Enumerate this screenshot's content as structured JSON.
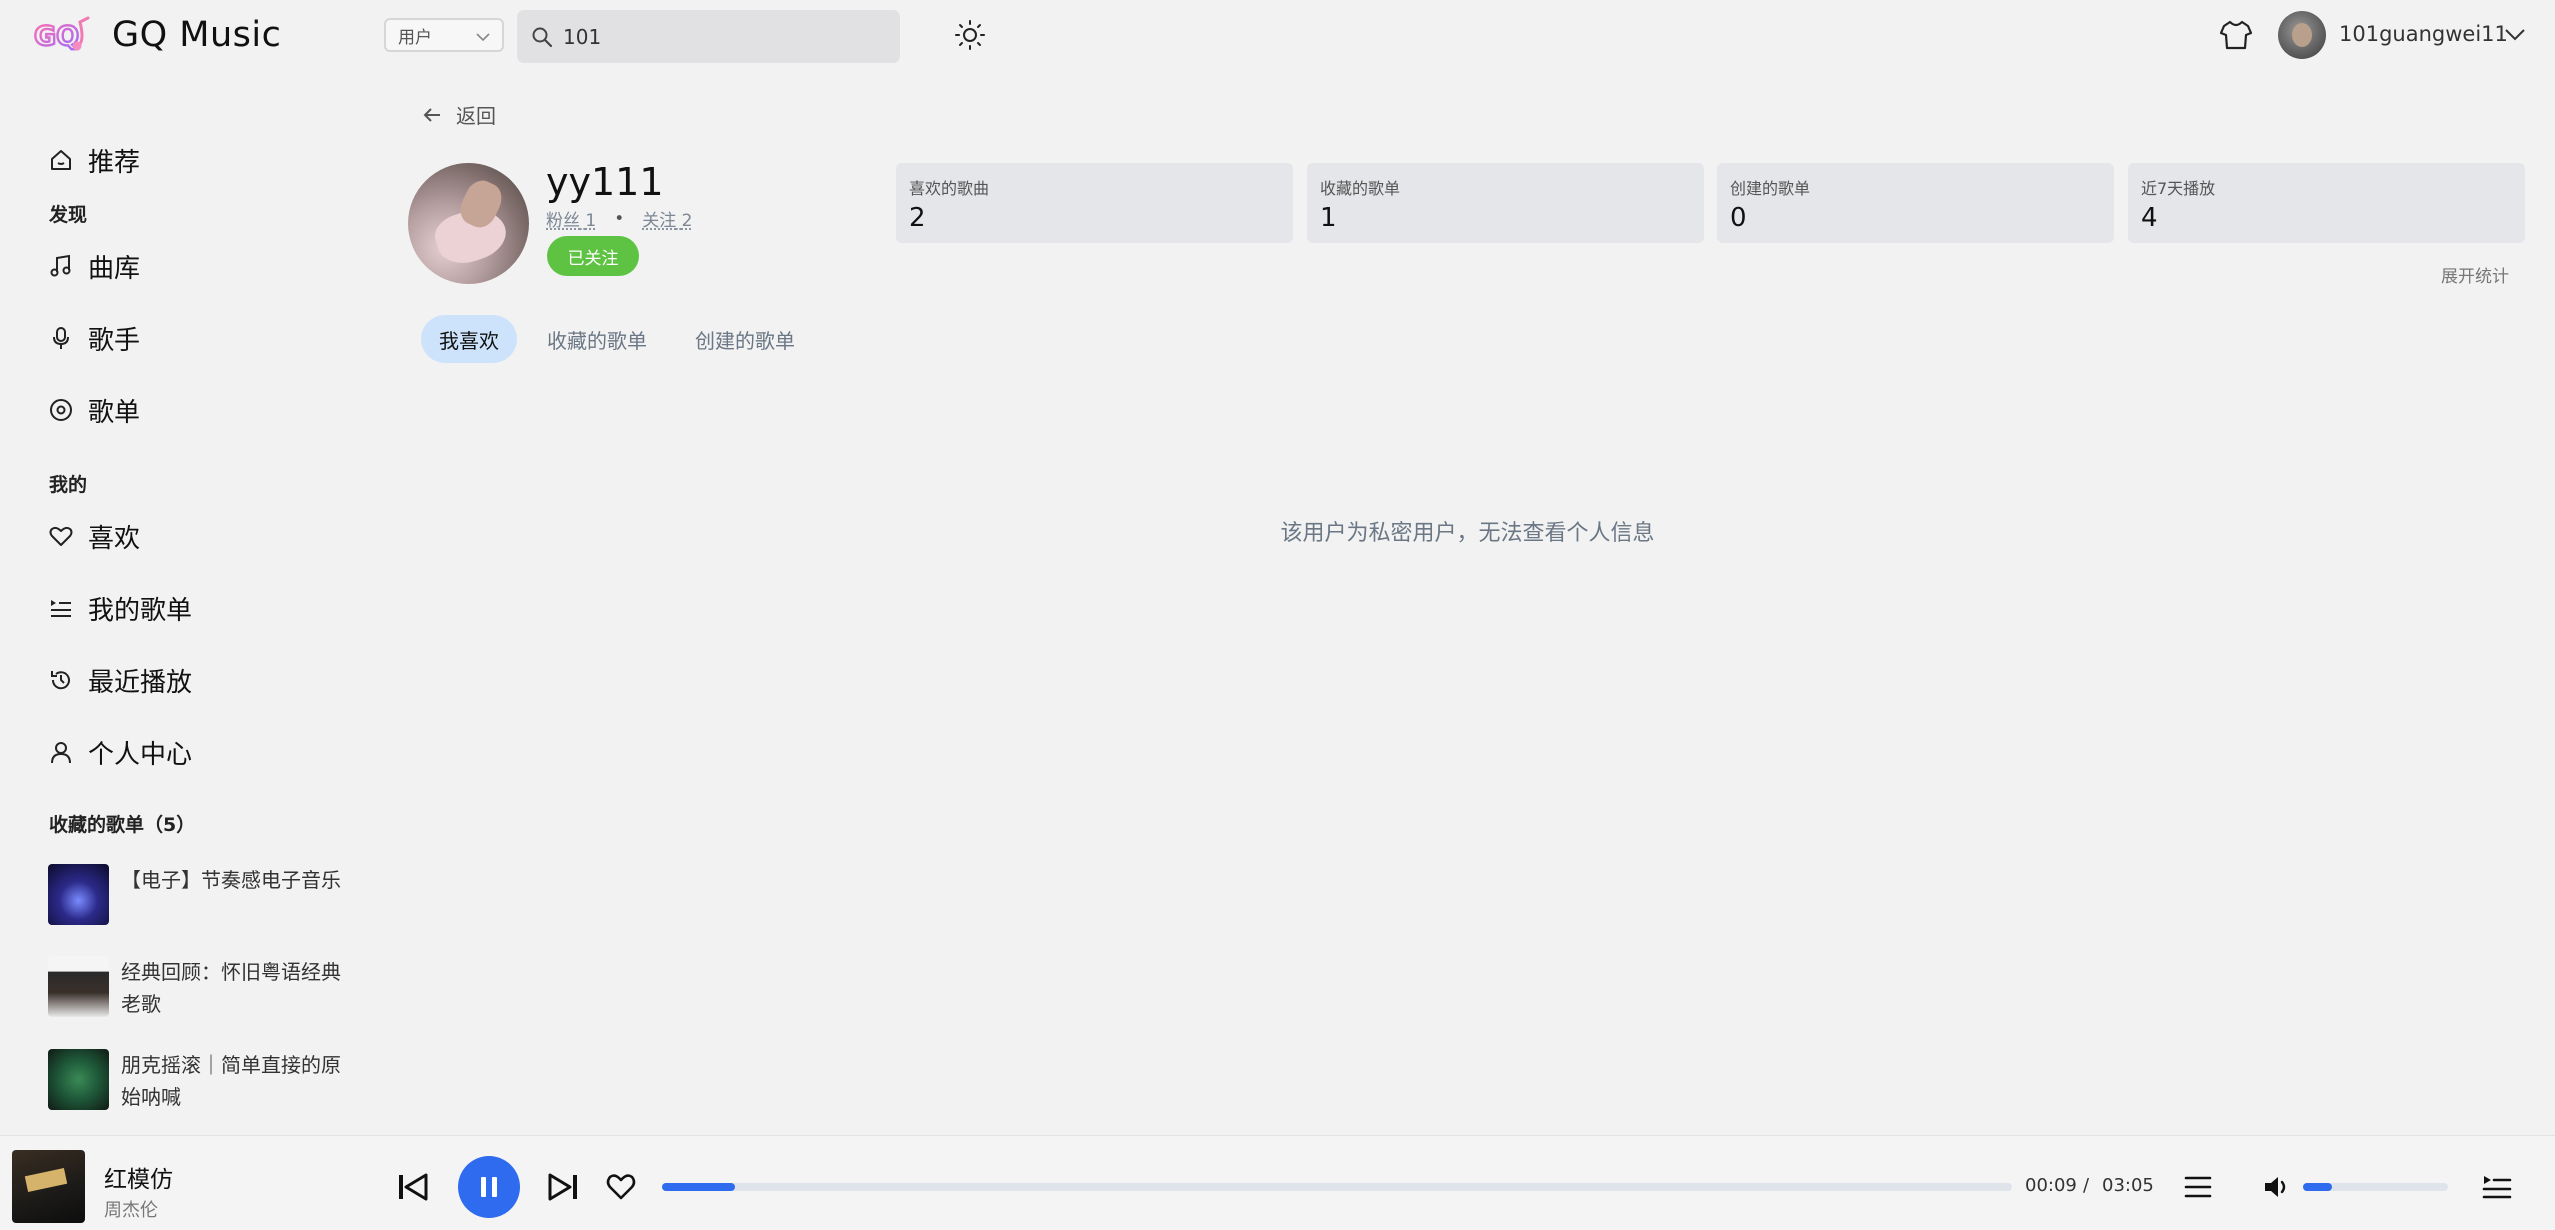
{
  "header": {
    "app_title": "GQ Music",
    "search_type": "用户",
    "search_value": "101",
    "user_name": "101guangwei11"
  },
  "sidebar": {
    "recommend": "推荐",
    "discover_title": "发现",
    "library": "曲库",
    "artists": "歌手",
    "playlists": "歌单",
    "mine_title": "我的",
    "liked": "喜欢",
    "my_playlists": "我的歌单",
    "recent": "最近播放",
    "profile": "个人中心",
    "collected_title": "收藏的歌单（5）",
    "collected": [
      {
        "title": "【电子】节奏感电子音乐"
      },
      {
        "title": "经典回顾：怀旧粤语经典老歌"
      },
      {
        "title": "朋克摇滚｜简单直接的原始呐喊"
      }
    ]
  },
  "main": {
    "back_label": "返回",
    "profile": {
      "name": "yy111",
      "fans_label": "粉丝",
      "fans_count": "1",
      "follow_label": "关注",
      "follow_count": "2",
      "followed_button": "已关注"
    },
    "stats": [
      {
        "label": "喜欢的歌曲",
        "value": "2"
      },
      {
        "label": "收藏的歌单",
        "value": "1"
      },
      {
        "label": "创建的歌单",
        "value": "0"
      },
      {
        "label": "近7天播放",
        "value": "4"
      }
    ],
    "expand_stats": "展开统计",
    "tabs": [
      "我喜欢",
      "收藏的歌单",
      "创建的歌单"
    ],
    "active_tab": "我喜欢",
    "private_message": "该用户为私密用户，无法查看个人信息"
  },
  "player": {
    "song_title": "红模仿",
    "artist": "周杰伦",
    "current_time": "00:09",
    "separator": "/",
    "total_time": "03:05",
    "progress_fraction": 0.054,
    "volume_fraction": 0.2
  },
  "colors": {
    "accent": "#2f6bef",
    "followed": "#5ec243",
    "active_tab": "#cde3fb"
  }
}
